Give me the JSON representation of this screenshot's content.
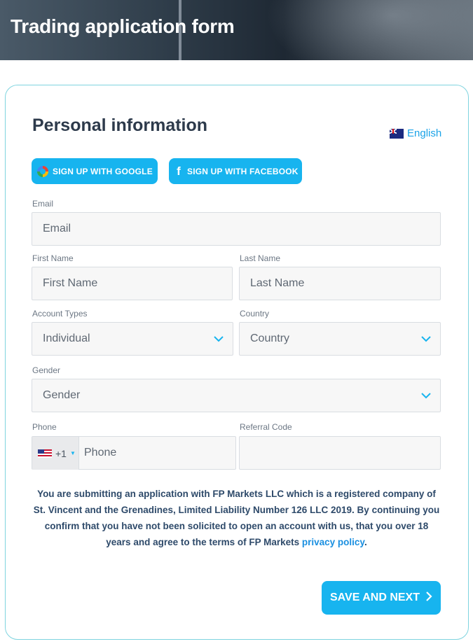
{
  "header": {
    "title": "Trading application form"
  },
  "section": {
    "title": "Personal information"
  },
  "language": {
    "label": "English",
    "flag": "australia-flag-icon"
  },
  "social": {
    "google_label": "SIGN UP WITH GOOGLE",
    "facebook_label": "SIGN UP WITH FACEBOOK"
  },
  "form": {
    "email": {
      "label": "Email",
      "placeholder": "Email"
    },
    "first_name": {
      "label": "First Name",
      "placeholder": "First Name"
    },
    "last_name": {
      "label": "Last Name",
      "placeholder": "Last Name"
    },
    "account_type": {
      "label": "Account Types",
      "value": "Individual"
    },
    "country": {
      "label": "Country",
      "value": "Country"
    },
    "gender": {
      "label": "Gender",
      "value": "Gender"
    },
    "phone": {
      "label": "Phone",
      "dial_code": "+1",
      "placeholder": "Phone"
    },
    "referral": {
      "label": "Referral Code",
      "placeholder": ""
    }
  },
  "notice": {
    "text": "You are submitting an application with FP Markets LLC which is a registered company of St. Vincent and the Grenadines, Limited Liability Number 126 LLC 2019. By continuing you confirm that you have not been solicited to open an account with us, that you over 18 years and agree to the terms of FP Markets ",
    "link": "privacy policy",
    "end": "."
  },
  "actions": {
    "save_label": "SAVE AND NEXT"
  },
  "colors": {
    "accent": "#17b4ef",
    "text": "#2d3a4b",
    "link": "#1a8fe0",
    "border": "#7fd4df"
  }
}
